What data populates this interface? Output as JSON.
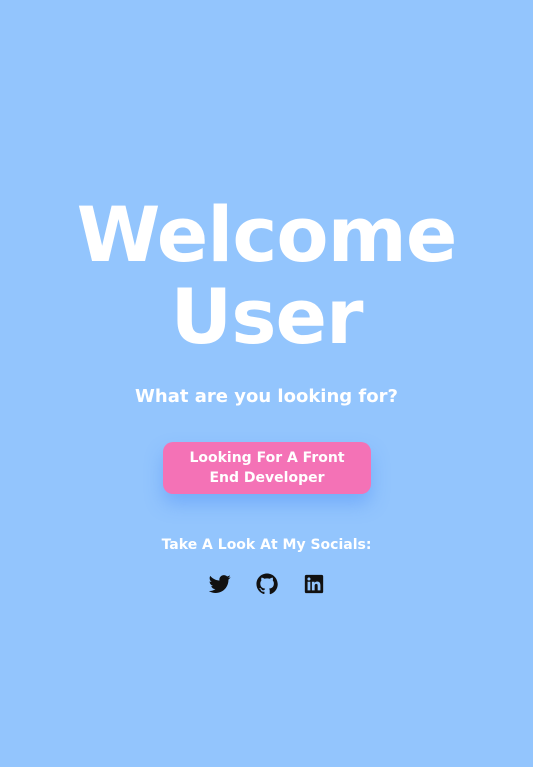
{
  "hero": {
    "title_line1": "Welcome",
    "title_line2": "User",
    "subtitle": "What are you looking for?",
    "cta_label": "Looking For A Front End Developer"
  },
  "socials": {
    "label": "Take A Look At My Socials:",
    "items": [
      {
        "name": "Twitter",
        "icon": "twitter-icon"
      },
      {
        "name": "GitHub",
        "icon": "github-icon"
      },
      {
        "name": "LinkedIn",
        "icon": "linkedin-icon"
      }
    ]
  },
  "colors": {
    "background": "#93c5fd",
    "text": "#ffffff",
    "button": "#f472b6",
    "icons": "#111111"
  }
}
